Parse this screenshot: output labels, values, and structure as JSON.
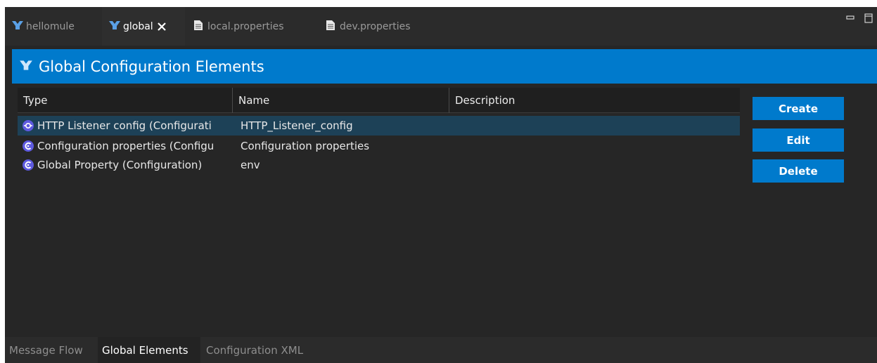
{
  "editor_tabs": [
    {
      "label": "hellomule",
      "icon": "mule-icon",
      "active": false
    },
    {
      "label": "global",
      "icon": "mule-icon",
      "active": true,
      "closable": true
    },
    {
      "label": "local.properties",
      "icon": "file-icon",
      "active": false
    },
    {
      "label": "dev.properties",
      "icon": "file-icon",
      "active": false
    }
  ],
  "header": {
    "title": "Global Configuration Elements",
    "icon": "mule-icon",
    "color": "#007acc"
  },
  "table": {
    "columns": [
      "Type",
      "Name",
      "Description"
    ],
    "rows": [
      {
        "type": "HTTP Listener config (Configurati",
        "name": "HTTP_Listener_config",
        "description": "",
        "icon": "http-listener-icon",
        "selected": true
      },
      {
        "type": "Configuration properties (Configu",
        "name": "Configuration properties",
        "description": "",
        "icon": "config-icon",
        "selected": false
      },
      {
        "type": "Global Property (Configuration)",
        "name": "env",
        "description": "",
        "icon": "config-icon",
        "selected": false
      }
    ]
  },
  "buttons": {
    "create": "Create",
    "edit": "Edit",
    "delete": "Delete"
  },
  "bottom_tabs": [
    {
      "label": "Message Flow",
      "active": false
    },
    {
      "label": "Global Elements",
      "active": true
    },
    {
      "label": "Configuration XML",
      "active": false
    }
  ],
  "colors": {
    "accent": "#007acc",
    "selected_row": "#1d4157",
    "background": "#262626",
    "icon_purple": "#5e5ae0"
  }
}
